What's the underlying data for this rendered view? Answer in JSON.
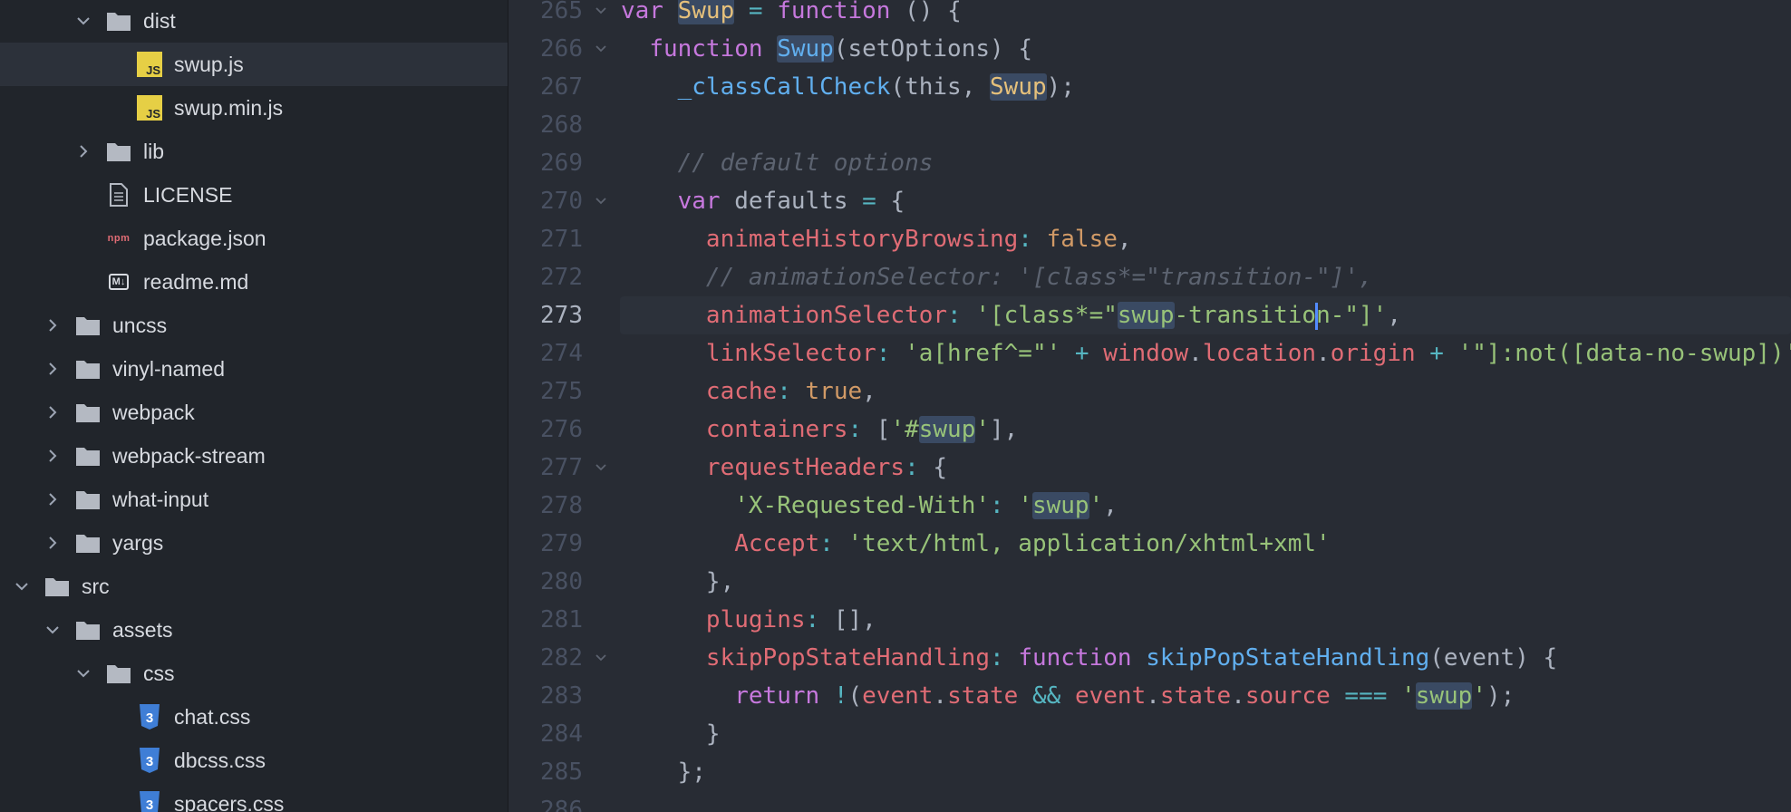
{
  "file_tree": {
    "items": [
      {
        "label": "dist",
        "type": "folder",
        "expanded": true,
        "depth": 2,
        "icon": "folder-icon"
      },
      {
        "label": "swup.js",
        "type": "file",
        "depth": 3,
        "icon": "js-file-icon",
        "selected": true
      },
      {
        "label": "swup.min.js",
        "type": "file",
        "depth": 3,
        "icon": "js-file-icon"
      },
      {
        "label": "lib",
        "type": "folder",
        "expanded": false,
        "depth": 2,
        "icon": "folder-icon"
      },
      {
        "label": "LICENSE",
        "type": "file",
        "depth": 2,
        "icon": "license-file-icon"
      },
      {
        "label": "package.json",
        "type": "file",
        "depth": 2,
        "icon": "npm-file-icon"
      },
      {
        "label": "readme.md",
        "type": "file",
        "depth": 2,
        "icon": "markdown-file-icon"
      },
      {
        "label": "uncss",
        "type": "folder",
        "expanded": false,
        "depth": 1,
        "icon": "folder-icon"
      },
      {
        "label": "vinyl-named",
        "type": "folder",
        "expanded": false,
        "depth": 1,
        "icon": "folder-icon"
      },
      {
        "label": "webpack",
        "type": "folder",
        "expanded": false,
        "depth": 1,
        "icon": "folder-icon"
      },
      {
        "label": "webpack-stream",
        "type": "folder",
        "expanded": false,
        "depth": 1,
        "icon": "folder-icon"
      },
      {
        "label": "what-input",
        "type": "folder",
        "expanded": false,
        "depth": 1,
        "icon": "folder-icon"
      },
      {
        "label": "yargs",
        "type": "folder",
        "expanded": false,
        "depth": 1,
        "icon": "folder-icon"
      },
      {
        "label": "src",
        "type": "folder",
        "expanded": true,
        "depth": 0,
        "icon": "folder-icon"
      },
      {
        "label": "assets",
        "type": "folder",
        "expanded": true,
        "depth": 1,
        "icon": "folder-icon"
      },
      {
        "label": "css",
        "type": "folder",
        "expanded": true,
        "depth": 2,
        "icon": "folder-icon"
      },
      {
        "label": "chat.css",
        "type": "file",
        "depth": 3,
        "icon": "css-file-icon"
      },
      {
        "label": "dbcss.css",
        "type": "file",
        "depth": 3,
        "icon": "css-file-icon"
      },
      {
        "label": "spacers.css",
        "type": "file",
        "depth": 3,
        "icon": "css-file-icon"
      }
    ]
  },
  "editor": {
    "active_line": 273,
    "lines": [
      {
        "num": "265",
        "fold": true,
        "tokens": [
          [
            "k",
            "var"
          ],
          [
            "p",
            " "
          ],
          [
            "v hl",
            "Swup"
          ],
          [
            "p",
            " "
          ],
          [
            "o",
            "="
          ],
          [
            "p",
            " "
          ],
          [
            "k",
            "function"
          ],
          [
            "p",
            " () {"
          ]
        ]
      },
      {
        "num": "266",
        "fold": true,
        "tokens": [
          [
            "p",
            "  "
          ],
          [
            "k",
            "function"
          ],
          [
            "p",
            " "
          ],
          [
            "fn hl",
            "Swup"
          ],
          [
            "p",
            "(setOptions) {"
          ]
        ]
      },
      {
        "num": "267",
        "fold": false,
        "tokens": [
          [
            "p",
            "    "
          ],
          [
            "fn",
            "_classCallCheck"
          ],
          [
            "p",
            "(this, "
          ],
          [
            "v hl",
            "Swup"
          ],
          [
            "p",
            ");"
          ]
        ]
      },
      {
        "num": "268",
        "fold": false,
        "tokens": []
      },
      {
        "num": "269",
        "fold": false,
        "tokens": [
          [
            "p",
            "    "
          ],
          [
            "c",
            "// default options"
          ]
        ]
      },
      {
        "num": "270",
        "fold": true,
        "tokens": [
          [
            "p",
            "    "
          ],
          [
            "k",
            "var"
          ],
          [
            "p",
            " defaults "
          ],
          [
            "o",
            "="
          ],
          [
            "p",
            " {"
          ]
        ]
      },
      {
        "num": "271",
        "fold": false,
        "tokens": [
          [
            "p",
            "      "
          ],
          [
            "pr",
            "animateHistoryBrowsing"
          ],
          [
            "o",
            ":"
          ],
          [
            "p",
            " "
          ],
          [
            "b",
            "false"
          ],
          [
            "p",
            ","
          ]
        ]
      },
      {
        "num": "272",
        "fold": false,
        "tokens": [
          [
            "p",
            "      "
          ],
          [
            "c",
            "// animationSelector: '[class*=\"transition-\"]',"
          ]
        ]
      },
      {
        "num": "273",
        "fold": false,
        "tokens": [
          [
            "p",
            "      "
          ],
          [
            "pr",
            "animationSelector"
          ],
          [
            "o",
            ":"
          ],
          [
            "p",
            " "
          ],
          [
            "s",
            "'[class*=\""
          ],
          [
            "s hl",
            "swup"
          ],
          [
            "s",
            "-transitio"
          ],
          [
            "cursor",
            ""
          ],
          [
            "s",
            "n-\"]'"
          ],
          [
            "p",
            ","
          ]
        ]
      },
      {
        "num": "274",
        "fold": false,
        "tokens": [
          [
            "p",
            "      "
          ],
          [
            "pr",
            "linkSelector"
          ],
          [
            "o",
            ":"
          ],
          [
            "p",
            " "
          ],
          [
            "s",
            "'a[href^=\"'"
          ],
          [
            "p",
            " "
          ],
          [
            "o",
            "+"
          ],
          [
            "p",
            " "
          ],
          [
            "pr",
            "window"
          ],
          [
            "p",
            "."
          ],
          [
            "pr",
            "location"
          ],
          [
            "p",
            "."
          ],
          [
            "pr",
            "origin"
          ],
          [
            "p",
            " "
          ],
          [
            "o",
            "+"
          ],
          [
            "p",
            " "
          ],
          [
            "s",
            "'\"]:not([data-no-swup])'"
          ]
        ]
      },
      {
        "num": "275",
        "fold": false,
        "tokens": [
          [
            "p",
            "      "
          ],
          [
            "pr",
            "cache"
          ],
          [
            "o",
            ":"
          ],
          [
            "p",
            " "
          ],
          [
            "b",
            "true"
          ],
          [
            "p",
            ","
          ]
        ]
      },
      {
        "num": "276",
        "fold": false,
        "tokens": [
          [
            "p",
            "      "
          ],
          [
            "pr",
            "containers"
          ],
          [
            "o",
            ":"
          ],
          [
            "p",
            " ["
          ],
          [
            "s",
            "'#"
          ],
          [
            "s hl",
            "swup"
          ],
          [
            "s",
            "'"
          ],
          [
            "p",
            "],"
          ]
        ]
      },
      {
        "num": "277",
        "fold": true,
        "tokens": [
          [
            "p",
            "      "
          ],
          [
            "pr",
            "requestHeaders"
          ],
          [
            "o",
            ":"
          ],
          [
            "p",
            " {"
          ]
        ]
      },
      {
        "num": "278",
        "fold": false,
        "tokens": [
          [
            "p",
            "        "
          ],
          [
            "s",
            "'X-Requested-With'"
          ],
          [
            "o",
            ":"
          ],
          [
            "p",
            " "
          ],
          [
            "s",
            "'"
          ],
          [
            "s hl",
            "swup"
          ],
          [
            "s",
            "'"
          ],
          [
            "p",
            ","
          ]
        ]
      },
      {
        "num": "279",
        "fold": false,
        "tokens": [
          [
            "p",
            "        "
          ],
          [
            "pr",
            "Accept"
          ],
          [
            "o",
            ":"
          ],
          [
            "p",
            " "
          ],
          [
            "s",
            "'text/html, application/xhtml+xml'"
          ]
        ]
      },
      {
        "num": "280",
        "fold": false,
        "tokens": [
          [
            "p",
            "      },"
          ]
        ]
      },
      {
        "num": "281",
        "fold": false,
        "tokens": [
          [
            "p",
            "      "
          ],
          [
            "pr",
            "plugins"
          ],
          [
            "o",
            ":"
          ],
          [
            "p",
            " [],"
          ]
        ]
      },
      {
        "num": "282",
        "fold": true,
        "tokens": [
          [
            "p",
            "      "
          ],
          [
            "pr",
            "skipPopStateHandling"
          ],
          [
            "o",
            ":"
          ],
          [
            "p",
            " "
          ],
          [
            "k",
            "function"
          ],
          [
            "p",
            " "
          ],
          [
            "fn",
            "skipPopStateHandling"
          ],
          [
            "p",
            "(event) {"
          ]
        ]
      },
      {
        "num": "283",
        "fold": false,
        "tokens": [
          [
            "p",
            "        "
          ],
          [
            "k",
            "return"
          ],
          [
            "p",
            " "
          ],
          [
            "o",
            "!"
          ],
          [
            "p",
            "("
          ],
          [
            "pr",
            "event"
          ],
          [
            "p",
            "."
          ],
          [
            "pr",
            "state"
          ],
          [
            "p",
            " "
          ],
          [
            "o",
            "&&"
          ],
          [
            "p",
            " "
          ],
          [
            "pr",
            "event"
          ],
          [
            "p",
            "."
          ],
          [
            "pr",
            "state"
          ],
          [
            "p",
            "."
          ],
          [
            "pr",
            "source"
          ],
          [
            "p",
            " "
          ],
          [
            "o",
            "==="
          ],
          [
            "p",
            " "
          ],
          [
            "s",
            "'"
          ],
          [
            "s hl",
            "swup"
          ],
          [
            "s",
            "'"
          ],
          [
            "p",
            ");"
          ]
        ]
      },
      {
        "num": "284",
        "fold": false,
        "tokens": [
          [
            "p",
            "      }"
          ]
        ]
      },
      {
        "num": "285",
        "fold": false,
        "tokens": [
          [
            "p",
            "    };"
          ]
        ]
      },
      {
        "num": "286",
        "fold": false,
        "tokens": []
      }
    ]
  },
  "colors": {
    "tree_background": "#21252b",
    "editor_background": "#282c34",
    "selection": "#2c313a",
    "keyword": "#c678dd",
    "string": "#98c379",
    "property": "#e06c75",
    "function": "#61afef",
    "comment": "#5c6370"
  }
}
